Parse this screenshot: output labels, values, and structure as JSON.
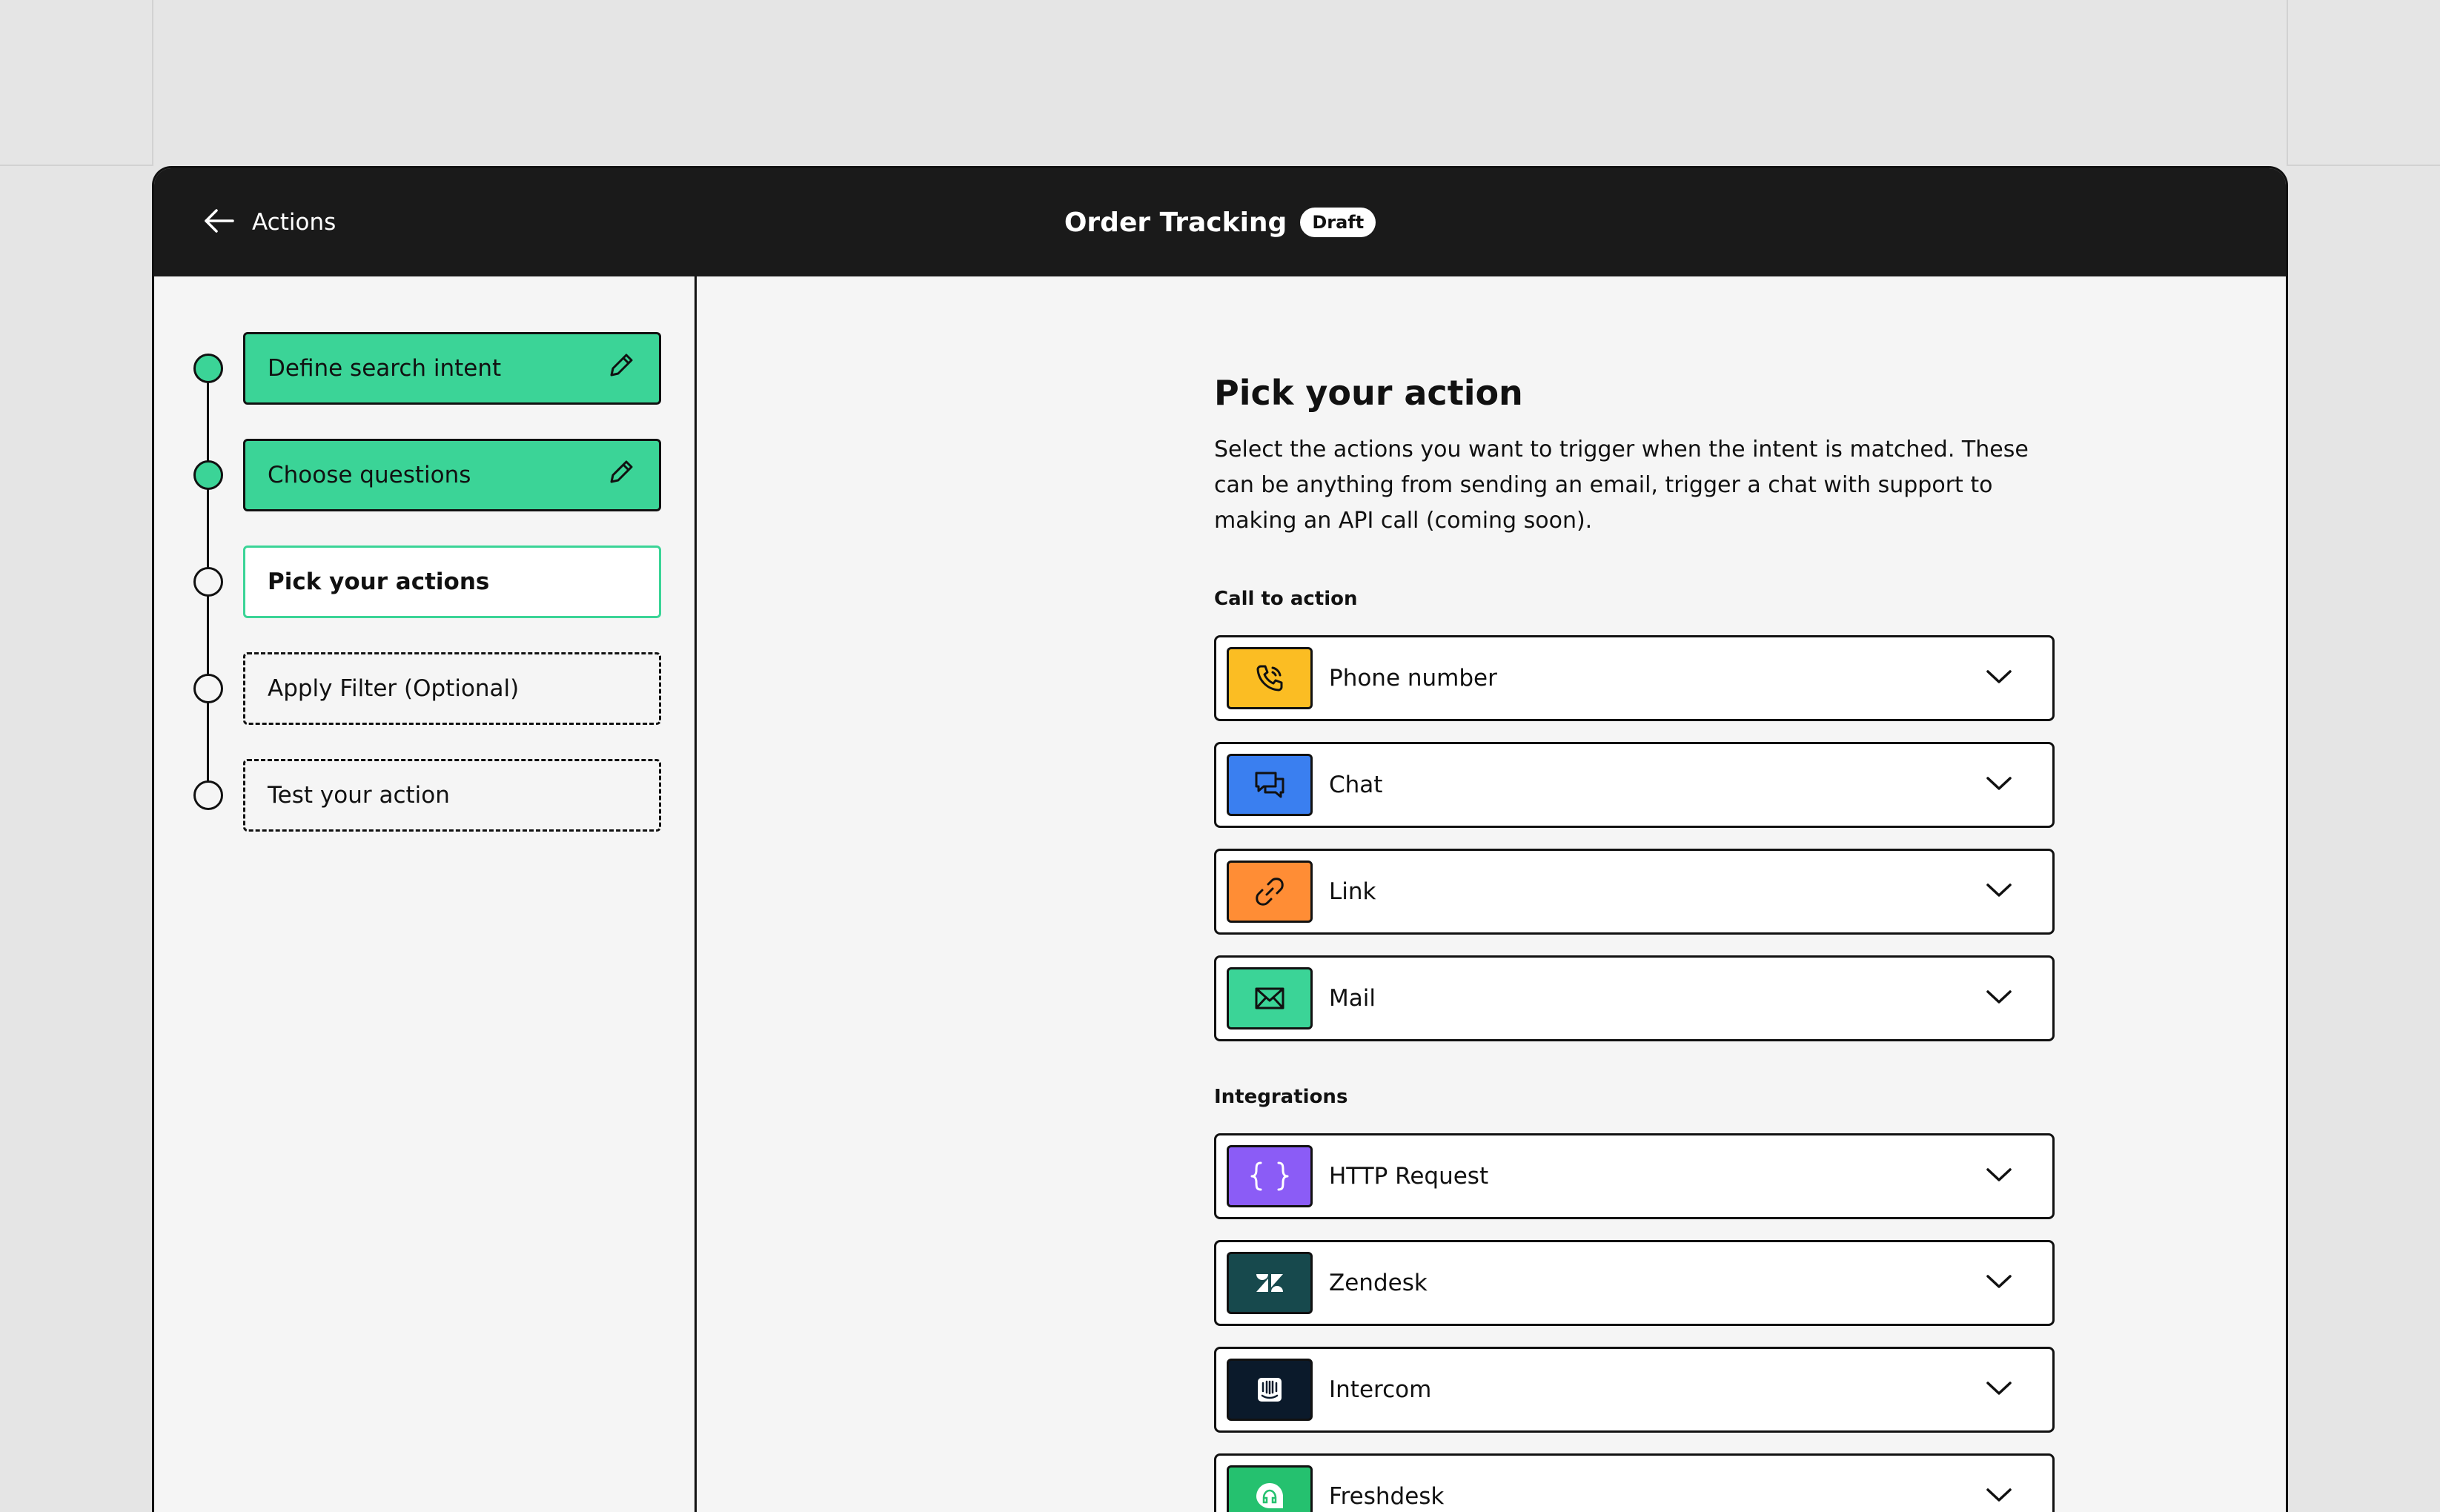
{
  "header": {
    "back_label": "Actions",
    "title": "Order Tracking",
    "badge": "Draft"
  },
  "steps": [
    {
      "label": "Define search intent",
      "state": "done"
    },
    {
      "label": "Choose questions",
      "state": "done"
    },
    {
      "label": "Pick your actions",
      "state": "active"
    },
    {
      "label": "Apply Filter (Optional)",
      "state": "todo"
    },
    {
      "label": "Test your action",
      "state": "todo"
    }
  ],
  "main": {
    "heading": "Pick your action",
    "description": "Select the actions you want to trigger when the intent is matched. These can be anything from sending an email, trigger a chat with support to making an API call (coming soon).",
    "cta_section": "Call to action",
    "integrations_section": "Integrations",
    "cta_items": [
      {
        "label": "Phone number",
        "icon": "phone-icon",
        "color": "#fbbd23"
      },
      {
        "label": "Chat",
        "icon": "chat-icon",
        "color": "#3a7ff0"
      },
      {
        "label": "Link",
        "icon": "link-icon",
        "color": "#ff8d35"
      },
      {
        "label": "Mail",
        "icon": "mail-icon",
        "color": "#3bd497"
      }
    ],
    "integration_items": [
      {
        "label": "HTTP Request",
        "icon": "braces-icon",
        "color": "#8b5cf6"
      },
      {
        "label": "Zendesk",
        "icon": "zendesk-icon",
        "color": "#17494d"
      },
      {
        "label": "Intercom",
        "icon": "intercom-icon",
        "color": "#0b1a2b"
      },
      {
        "label": "Freshdesk",
        "icon": "freshdesk-icon",
        "color": "#25c16f"
      }
    ]
  },
  "colors": {
    "accent": "#3bd497",
    "topbar": "#1a1a1a",
    "panel": "#f5f5f5"
  }
}
